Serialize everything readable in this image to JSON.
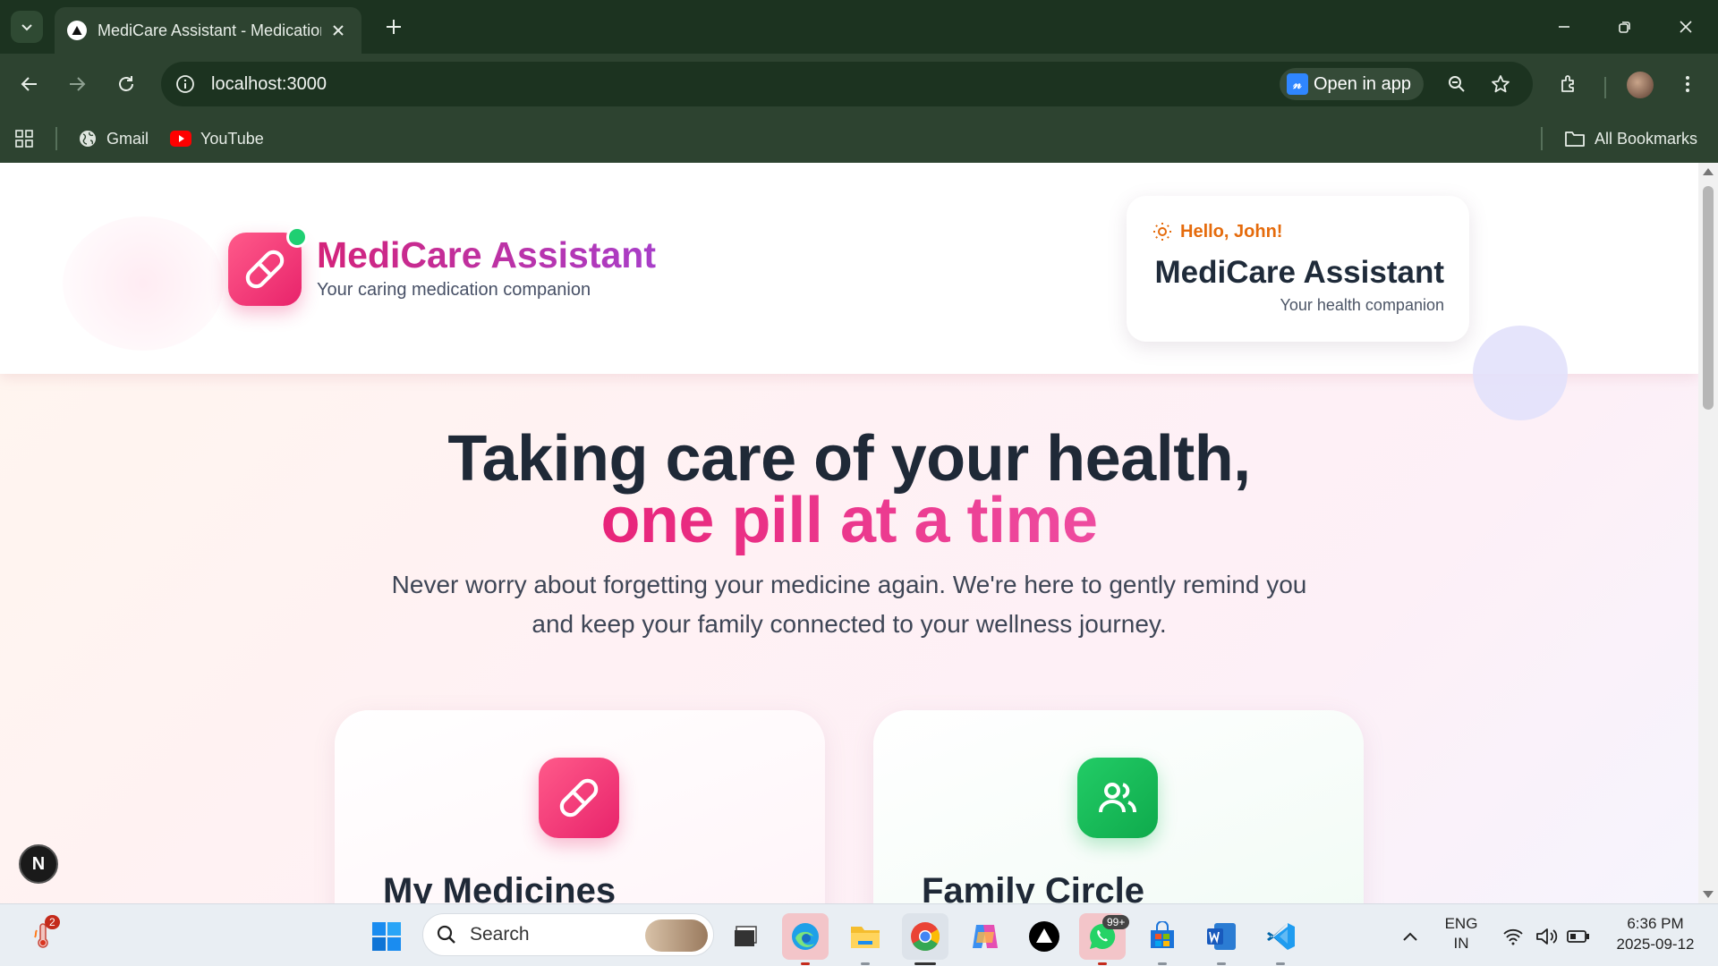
{
  "browser": {
    "tab": {
      "title": "MediCare Assistant - Medication"
    },
    "address": {
      "url": "localhost:3000"
    },
    "open_in_app": "Open in app",
    "open_in_app_logo": "𝓃",
    "bookmarks": [
      {
        "label": "Gmail"
      },
      {
        "label": "YouTube"
      }
    ],
    "all_bookmarks": "All Bookmarks"
  },
  "header": {
    "brand_title": "MediCare Assistant",
    "brand_subtitle": "Your caring medication companion",
    "greeting": "Hello, John!",
    "card_title": "MediCare Assistant",
    "card_subtitle": "Your health companion"
  },
  "hero": {
    "line1": "Taking care of your health,",
    "line2": "one pill at a time",
    "description": "Never worry about forgetting your medicine again. We're here to gently remind you and keep your family connected to your wellness journey."
  },
  "cards": [
    {
      "title": "My Medicines",
      "icon": "pill-icon",
      "color": "#ef3d7a"
    },
    {
      "title": "Family Circle",
      "icon": "users-icon",
      "color": "#18b955"
    }
  ],
  "dev_badge": "N",
  "taskbar": {
    "search_placeholder": "Search",
    "weather_badge": "2",
    "whatsapp_badge": "99+",
    "lang_line1": "ENG",
    "lang_line2": "IN",
    "time": "6:36 PM",
    "date": "2025-09-12"
  },
  "colors": {
    "accent_pink": "#e8236b",
    "accent_purple": "#a83ec9",
    "accent_green": "#18b955",
    "greeting_orange": "#e56b0c",
    "browser_chrome": "#2d4330"
  }
}
